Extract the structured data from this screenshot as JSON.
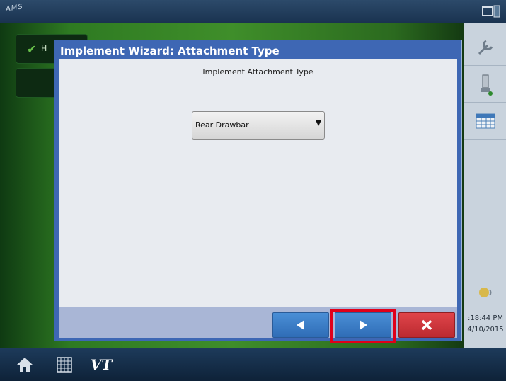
{
  "top_bar": {
    "logo_text": "AMS"
  },
  "background": {
    "list_item_label": "H"
  },
  "dialog": {
    "title": "Implement Wizard:  Attachment Type",
    "section_label": "Implement Attachment Type",
    "attachment_select": {
      "value": "Rear Drawbar"
    }
  },
  "footer": {
    "back_icon": "left-triangle-icon",
    "next_icon": "right-triangle-icon",
    "cancel_icon": "close-x-icon",
    "highlighted_button": "next"
  },
  "right_panel": {
    "icons": [
      "wrench-icon",
      "implement-icon",
      "calendar-grid-icon",
      "alert-bell-icon"
    ],
    "time": ":18:44 PM",
    "date": "4/10/2015"
  },
  "bottom_bar": {
    "items": [
      "home-icon",
      "grid-icon",
      "vt-icon"
    ],
    "vt_label": "VT"
  },
  "colors": {
    "dialog_header": "#3e67b4",
    "button_blue": "#3a7cc6",
    "button_red": "#cc3338",
    "highlight": "#e0001a"
  }
}
